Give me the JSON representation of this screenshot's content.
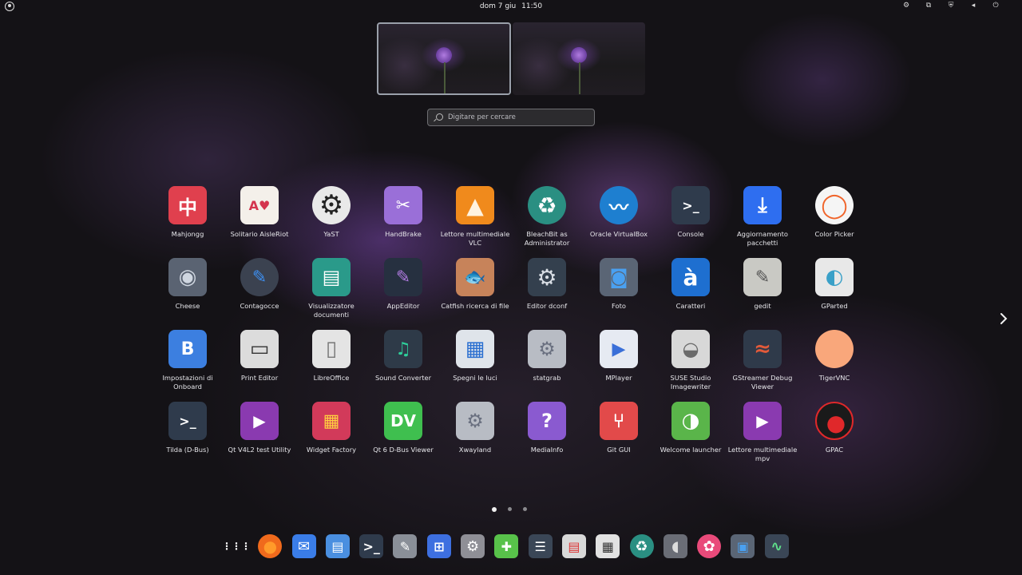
{
  "topbar": {
    "date": "dom 7 giu",
    "time": "11:50",
    "tray_icons": [
      "settings-icon",
      "screen-share-icon",
      "shield-icon",
      "volume-icon",
      "power-icon"
    ]
  },
  "search": {
    "placeholder": "Digitare per cercare"
  },
  "apps": [
    {
      "label": "Mahjongg",
      "icon": "mahjongg-icon",
      "color": "#e0404e"
    },
    {
      "label": "Solitario AisleRiot",
      "icon": "cards-icon",
      "color": "#f4f0ea"
    },
    {
      "label": "YaST",
      "icon": "gear-icon",
      "color": "#e9e9e9"
    },
    {
      "label": "HandBrake",
      "icon": "clapper-icon",
      "color": "#9a6fd8"
    },
    {
      "label": "Lettore multimediale VLC",
      "icon": "vlc-cone-icon",
      "color": "#f08a1c"
    },
    {
      "label": "BleachBit as Administrator",
      "icon": "recycle-icon",
      "color": "#2a8f82"
    },
    {
      "label": "Oracle VirtualBox",
      "icon": "waveform-icon",
      "color": "#1e7fd0"
    },
    {
      "label": "Console",
      "icon": "terminal-icon",
      "color": "#2f3b4c"
    },
    {
      "label": "Aggiornamento pacchetti",
      "icon": "software-update-icon",
      "color": "#2e6ef0"
    },
    {
      "label": "Color Picker",
      "icon": "color-ring-icon",
      "color": "#f5f5f5"
    },
    {
      "label": "Cheese",
      "icon": "camera-icon",
      "color": "#5a6372"
    },
    {
      "label": "Contagocce",
      "icon": "eyedropper-icon",
      "color": "#3b4250"
    },
    {
      "label": "Visualizzatore documenti",
      "icon": "document-viewer-icon",
      "color": "#2a9a8a"
    },
    {
      "label": "AppEditor",
      "icon": "app-editor-icon",
      "color": "#263040"
    },
    {
      "label": "Catfish ricerca di file",
      "icon": "catfish-icon",
      "color": "#c7835a"
    },
    {
      "label": "Editor dconf",
      "icon": "gears-icon",
      "color": "#34404e"
    },
    {
      "label": "Foto",
      "icon": "photo-camera-icon",
      "color": "#5a6575"
    },
    {
      "label": "Caratteri",
      "icon": "characters-icon",
      "color": "#1e6fd0"
    },
    {
      "label": "gedit",
      "icon": "text-editor-icon",
      "color": "#c9c9c4"
    },
    {
      "label": "GParted",
      "icon": "disk-icon",
      "color": "#e8e8e8"
    },
    {
      "label": "Impostazioni di Onboard",
      "icon": "keyboard-icon",
      "color": "#3c7fe0"
    },
    {
      "label": "Print Editor",
      "icon": "printer-icon",
      "color": "#dcdcdc"
    },
    {
      "label": "LibreOffice",
      "icon": "libreoffice-icon",
      "color": "#e4e4e4"
    },
    {
      "label": "Sound Converter",
      "icon": "sound-converter-icon",
      "color": "#2e3a48"
    },
    {
      "label": "Spegni le luci",
      "icon": "lights-off-icon",
      "color": "#dfe4ea"
    },
    {
      "label": "statgrab",
      "icon": "statgrab-icon",
      "color": "#b8bcc4"
    },
    {
      "label": "MPlayer",
      "icon": "mplayer-icon",
      "color": "#e6eaf2"
    },
    {
      "label": "SUSE Studio Imagewriter",
      "icon": "suse-disk-icon",
      "color": "#d8d8d8"
    },
    {
      "label": "GStreamer Debug Viewer",
      "icon": "gstreamer-icon",
      "color": "#2f3a4a"
    },
    {
      "label": "TigerVNC",
      "icon": "tigervnc-icon",
      "color": "#f9a77b"
    },
    {
      "label": "Tilda (D-Bus)",
      "icon": "terminal-icon",
      "color": "#2f3b4c"
    },
    {
      "label": "Qt V4L2 test Utility",
      "icon": "video-player-icon",
      "color": "#8a3ab0"
    },
    {
      "label": "Widget Factory",
      "icon": "widget-factory-icon",
      "color": "#d23a5a"
    },
    {
      "label": "Qt 6 D-Bus Viewer",
      "icon": "dbus-viewer-icon",
      "color": "#3fbf4f"
    },
    {
      "label": "Xwayland",
      "icon": "xwayland-icon",
      "color": "#b8bcc4"
    },
    {
      "label": "MediaInfo",
      "icon": "mediainfo-icon",
      "color": "#8a5ad0"
    },
    {
      "label": "Git GUI",
      "icon": "git-icon",
      "color": "#e24a4a"
    },
    {
      "label": "Welcome launcher",
      "icon": "opensuse-icon",
      "color": "#5ab54a"
    },
    {
      "label": "Lettore multimediale mpv",
      "icon": "video-player-icon",
      "color": "#8a3ab0"
    },
    {
      "label": "GPAC",
      "icon": "gpac-icon",
      "color": "#1a1a1a"
    }
  ],
  "pagination": {
    "pages": 3,
    "active": 1
  },
  "dock": [
    {
      "name": "show-apps-icon"
    },
    {
      "name": "firefox-icon",
      "color": "#f06a1c"
    },
    {
      "name": "mail-icon",
      "color": "#3a7de8"
    },
    {
      "name": "file-cabinet-icon",
      "color": "#4a8fe0"
    },
    {
      "name": "terminal-icon",
      "color": "#2f3b4c"
    },
    {
      "name": "document-edit-icon",
      "color": "#8a8f98"
    },
    {
      "name": "software-store-icon",
      "color": "#3d6fe0"
    },
    {
      "name": "settings-gear-icon",
      "color": "#8f8f96"
    },
    {
      "name": "extensions-icon",
      "color": "#58c24a"
    },
    {
      "name": "tweaks-icon",
      "color": "#3a4656"
    },
    {
      "name": "shredder-icon",
      "color": "#d8d8d8"
    },
    {
      "name": "calculator-icon",
      "color": "#e2e2e2"
    },
    {
      "name": "bleachbit-icon",
      "color": "#2a8f82"
    },
    {
      "name": "audio-icon",
      "color": "#6a6d76"
    },
    {
      "name": "flower-icon",
      "color": "#e94a7a"
    },
    {
      "name": "remote-desktop-icon",
      "color": "#5a6575"
    },
    {
      "name": "system-monitor-icon",
      "color": "#3a4656"
    }
  ]
}
